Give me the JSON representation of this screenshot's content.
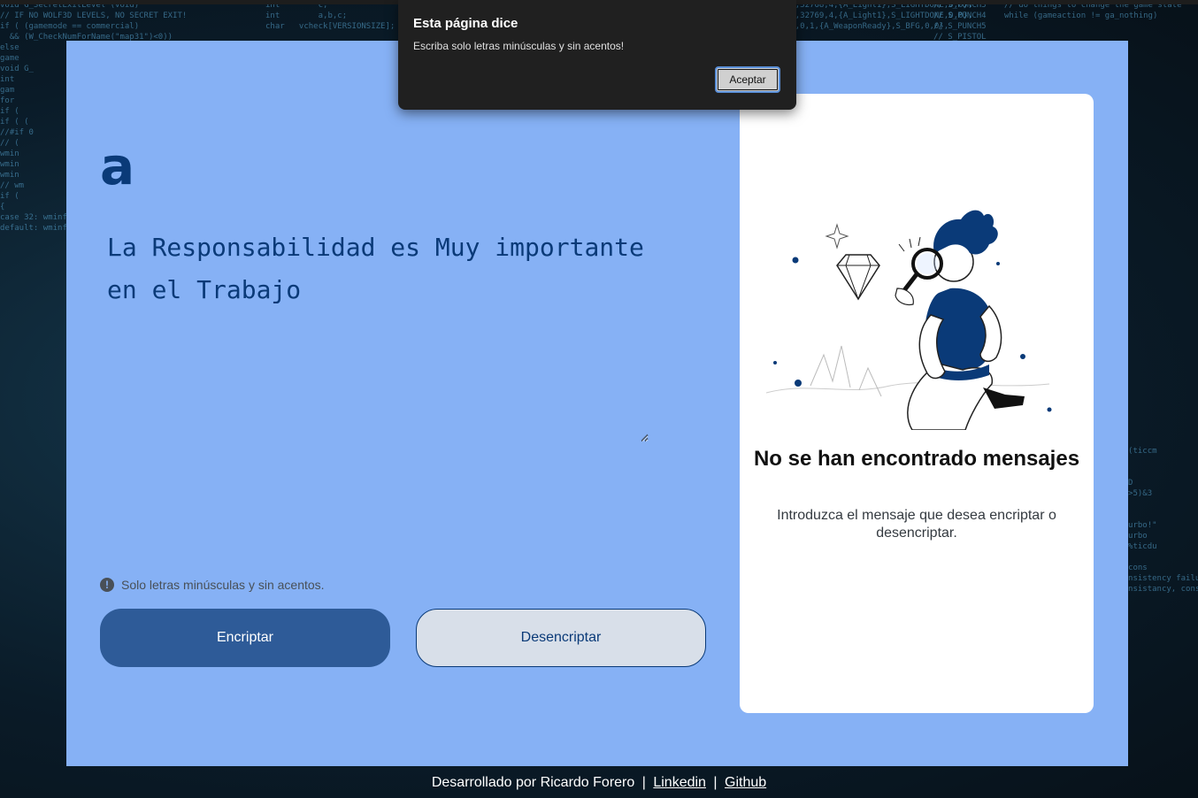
{
  "dialog": {
    "title": "Esta página dice",
    "message": "Escriba solo letras minúsculas y sin acentos!",
    "accept_label": "Aceptar"
  },
  "logo": {
    "text": "a"
  },
  "editor": {
    "value": "La Responsabilidad es Muy importante en el Trabajo"
  },
  "hint": {
    "icon": "info-icon",
    "text": "Solo letras minúsculas y sin acentos."
  },
  "buttons": {
    "encrypt_label": "Encriptar",
    "decrypt_label": "Desencriptar"
  },
  "result": {
    "title": "No se han encontrado mensajes",
    "description": "Introduzca el mensaje que desea encriptar o desencriptar."
  },
  "footer": {
    "credit": "Desarrollado por Ricardo Forero",
    "separator": "|",
    "linkedin": "Linkedin",
    "github": "Github"
  },
  "colors": {
    "panel": "#86b1f5",
    "accent": "#0a3a78",
    "encrypt_button": "#2e5b98",
    "decrypt_button": "#d8dfe9"
  }
}
